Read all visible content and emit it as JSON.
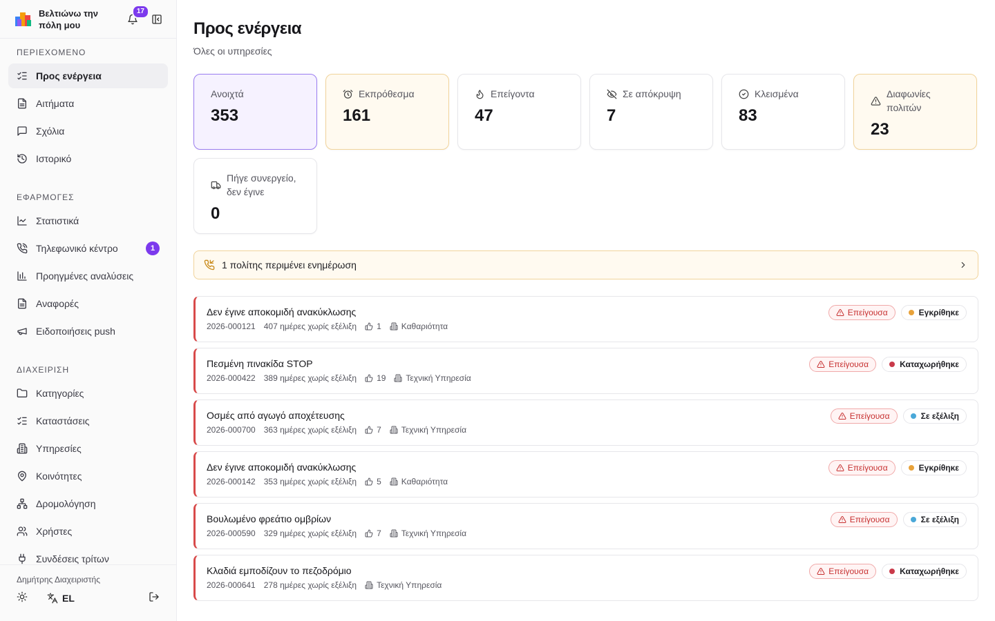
{
  "app": {
    "title": "Βελτιώνω την πόλη μου",
    "notifications": "17"
  },
  "sidebar": {
    "sections": [
      {
        "title": "ΠΕΡΙΕΧΟΜΕΝΟ",
        "items": [
          {
            "label": "Προς ενέργεια",
            "icon": "list-check-icon",
            "active": true
          },
          {
            "label": "Αιτήματα",
            "icon": "file-icon"
          },
          {
            "label": "Σχόλια",
            "icon": "comment-icon"
          },
          {
            "label": "Ιστορικό",
            "icon": "history-icon"
          }
        ]
      },
      {
        "title": "ΕΦΑΡΜΟΓΕΣ",
        "items": [
          {
            "label": "Στατιστικά",
            "icon": "line-chart-icon"
          },
          {
            "label": "Τηλεφωνικό κέντρο",
            "icon": "phone-icon",
            "count": "1"
          },
          {
            "label": "Προηγμένες αναλύσεις",
            "icon": "bar-chart-icon"
          },
          {
            "label": "Αναφορές",
            "icon": "file-icon"
          },
          {
            "label": "Ειδοποιήσεις push",
            "icon": "megaphone-icon"
          }
        ]
      },
      {
        "title": "ΔΙΑΧΕΙΡΙΣΗ",
        "items": [
          {
            "label": "Κατηγορίες",
            "icon": "folder-icon"
          },
          {
            "label": "Καταστάσεις",
            "icon": "list-check-icon"
          },
          {
            "label": "Υπηρεσίες",
            "icon": "building-icon"
          },
          {
            "label": "Κοινότητες",
            "icon": "map-pin-icon"
          },
          {
            "label": "Δρομολόγηση",
            "icon": "network-icon"
          },
          {
            "label": "Χρήστες",
            "icon": "users-icon"
          },
          {
            "label": "Συνδέσεις τρίτων",
            "icon": "plug-icon"
          }
        ]
      }
    ],
    "footer": {
      "user": "Δημήτρης Διαχειριστής",
      "lang": "EL"
    }
  },
  "page": {
    "title": "Προς ενέργεια",
    "subtitle": "Όλες οι υπηρεσίες"
  },
  "stats": [
    {
      "label": "Ανοιχτά",
      "value": "353",
      "icon": "",
      "style": "open"
    },
    {
      "label": "Εκπρόθεσμα",
      "value": "161",
      "icon": "alarm-icon",
      "style": "warn"
    },
    {
      "label": "Επείγοντα",
      "value": "47",
      "icon": "flame-icon",
      "style": ""
    },
    {
      "label": "Σε απόκρυψη",
      "value": "7",
      "icon": "eye-off-icon",
      "style": ""
    },
    {
      "label": "Κλεισμένα",
      "value": "83",
      "icon": "check-circle-icon",
      "style": ""
    },
    {
      "label": "Διαφωνίες πολιτών",
      "value": "23",
      "icon": "warning-icon",
      "style": "warn"
    },
    {
      "label": "Πήγε συνεργείο, δεν έγινε",
      "value": "0",
      "icon": "truck-icon",
      "style": ""
    }
  ],
  "banner": {
    "text": "1 πολίτης περιμένει ενημέρωση"
  },
  "colors": {
    "accent": "#7c3aed",
    "urgent": "#d84a4a",
    "approved": "#e8a23a",
    "registered": "#c93a4a",
    "progress": "#4aa8d8"
  },
  "requests": [
    {
      "title": "Δεν έγινε αποκομιδή ανακύκλωσης",
      "id": "2026-000121",
      "age": "407 ημέρες χωρίς εξέλιξη",
      "likes": "1",
      "service": "Καθαριότητα",
      "urgent": "Επείγουσα",
      "status": "Εγκρίθηκε",
      "status_color": "#e8a23a"
    },
    {
      "title": "Πεσμένη πινακίδα STOP",
      "id": "2026-000422",
      "age": "389 ημέρες χωρίς εξέλιξη",
      "likes": "19",
      "service": "Τεχνική Υπηρεσία",
      "urgent": "Επείγουσα",
      "status": "Καταχωρήθηκε",
      "status_color": "#c93a4a"
    },
    {
      "title": "Οσμές από αγωγό αποχέτευσης",
      "id": "2026-000700",
      "age": "363 ημέρες χωρίς εξέλιξη",
      "likes": "7",
      "service": "Τεχνική Υπηρεσία",
      "urgent": "Επείγουσα",
      "status": "Σε εξέλιξη",
      "status_color": "#4aa8d8"
    },
    {
      "title": "Δεν έγινε αποκομιδή ανακύκλωσης",
      "id": "2026-000142",
      "age": "353 ημέρες χωρίς εξέλιξη",
      "likes": "5",
      "service": "Καθαριότητα",
      "urgent": "Επείγουσα",
      "status": "Εγκρίθηκε",
      "status_color": "#e8a23a"
    },
    {
      "title": "Βουλωμένο φρεάτιο ομβρίων",
      "id": "2026-000590",
      "age": "329 ημέρες χωρίς εξέλιξη",
      "likes": "7",
      "service": "Τεχνική Υπηρεσία",
      "urgent": "Επείγουσα",
      "status": "Σε εξέλιξη",
      "status_color": "#4aa8d8"
    },
    {
      "title": "Κλαδιά εμποδίζουν το πεζοδρόμιο",
      "id": "2026-000641",
      "age": "278 ημέρες χωρίς εξέλιξη",
      "likes": "",
      "service": "Τεχνική Υπηρεσία",
      "urgent": "Επείγουσα",
      "status": "Καταχωρήθηκε",
      "status_color": "#c93a4a"
    }
  ]
}
